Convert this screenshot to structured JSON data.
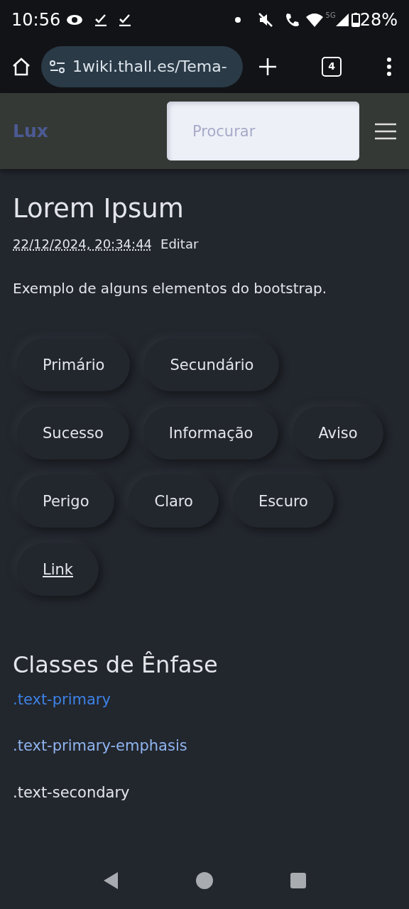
{
  "status_bar": {
    "time": "10:56",
    "signal_label": "5G",
    "battery": "28%"
  },
  "browser": {
    "url": "1wiki.thall.es/Tema-",
    "tab_count": "4"
  },
  "navbar": {
    "brand": "Lux",
    "search": {
      "placeholder": "Procurar"
    }
  },
  "page": {
    "title": "Lorem Ipsum",
    "timestamp": "22/12/2024, 20:34:44",
    "edit_link": "Editar",
    "intro": "Exemplo de alguns elementos do bootstrap."
  },
  "buttons": [
    {
      "label": "Primário",
      "kind": "button"
    },
    {
      "label": "Secundário",
      "kind": "button"
    },
    {
      "label": "Sucesso",
      "kind": "button"
    },
    {
      "label": "Informação",
      "kind": "button"
    },
    {
      "label": "Aviso",
      "kind": "button"
    },
    {
      "label": "Perigo",
      "kind": "button"
    },
    {
      "label": "Claro",
      "kind": "button"
    },
    {
      "label": "Escuro",
      "kind": "button"
    },
    {
      "label": "Link",
      "kind": "link"
    }
  ],
  "emphasis": {
    "heading": "Classes de Ênfase",
    "items": [
      {
        "text": ".text-primary",
        "kind": "primary"
      },
      {
        "text": ".text-primary-emphasis",
        "kind": "primary-emphasis"
      },
      {
        "text": ".text-secondary",
        "kind": "secondary"
      }
    ]
  }
}
